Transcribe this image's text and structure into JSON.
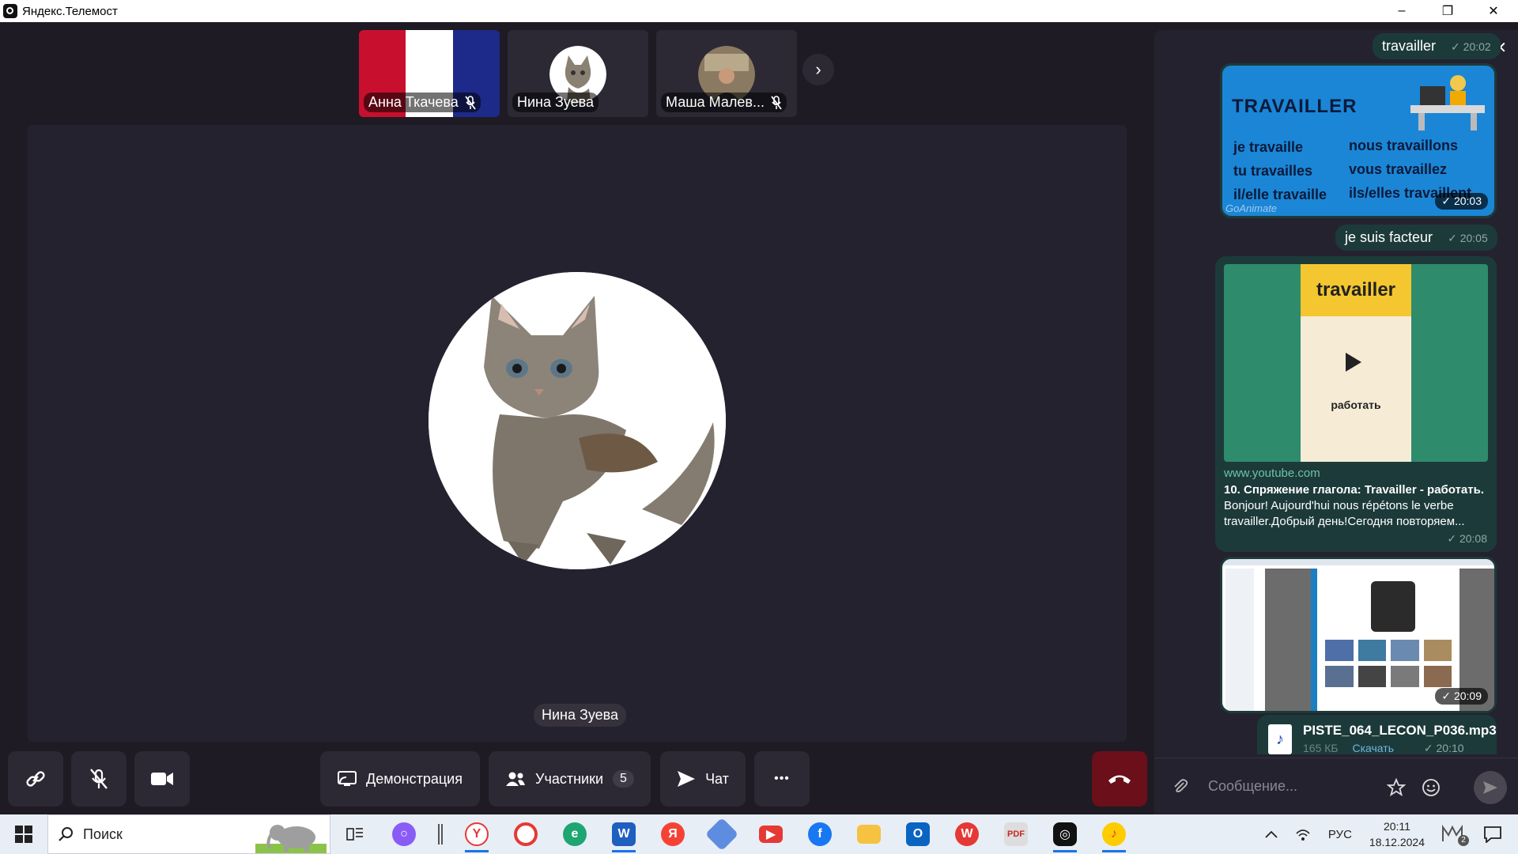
{
  "window": {
    "title": "Яндекс.Телемост",
    "minimize": "–",
    "restore": "❐",
    "close": "✕"
  },
  "participants_strip": [
    {
      "name": "Анна Ткачева",
      "muted": true,
      "background": "french-flag"
    },
    {
      "name": "Нина Зуева",
      "muted": false,
      "background": "cat-avatar"
    },
    {
      "name": "Маша Малев...",
      "muted": true,
      "background": "person-avatar"
    }
  ],
  "strip_next": "›",
  "stage": {
    "speaker_name": "Нина Зуева"
  },
  "controls": {
    "demonstration": "Демонстрация",
    "participants": "Участники",
    "participants_count": "5",
    "chat": "Чат",
    "more": "•••"
  },
  "chat": {
    "close": "✕",
    "messages": [
      {
        "type": "text",
        "text": "travailler",
        "time": "20:02"
      },
      {
        "type": "image",
        "title": "TRAVAILLER",
        "lines_left": [
          "je travaille",
          "tu travailles",
          "il/elle travaille"
        ],
        "lines_right": [
          "nous travaillons",
          "vous travaillez",
          "ils/elles travaillent"
        ],
        "watermark": "GoAnimate",
        "time": "20:03"
      },
      {
        "type": "text",
        "text": "je suis facteur",
        "time": "20:05"
      },
      {
        "type": "link",
        "video_title": "travailler",
        "video_sub": "работать",
        "domain": "www.youtube.com",
        "title": "10. Спряжение глагола: Travailler - работать.",
        "description": "Bonjour! Aujourd'hui nous répétons le verbe travailler.Добрый день!Сегодня повторяем...",
        "time": "20:08"
      },
      {
        "type": "image",
        "time": "20:09"
      },
      {
        "type": "file",
        "filename": "PISTE_064_LECON_P036.mp3",
        "size": "165 КБ",
        "download": "Скачать",
        "time": "20:10"
      }
    ],
    "input_placeholder": "Сообщение..."
  },
  "taskbar": {
    "search_label": "Поиск",
    "lang": "РУС",
    "time": "20:11",
    "date": "18.12.2024",
    "notif_count": "2"
  },
  "colors": {
    "bg": "#1e1b24",
    "bubble": "#1d3a3a",
    "hangup": "#6b0f1a",
    "accent": "#1a73e8"
  }
}
